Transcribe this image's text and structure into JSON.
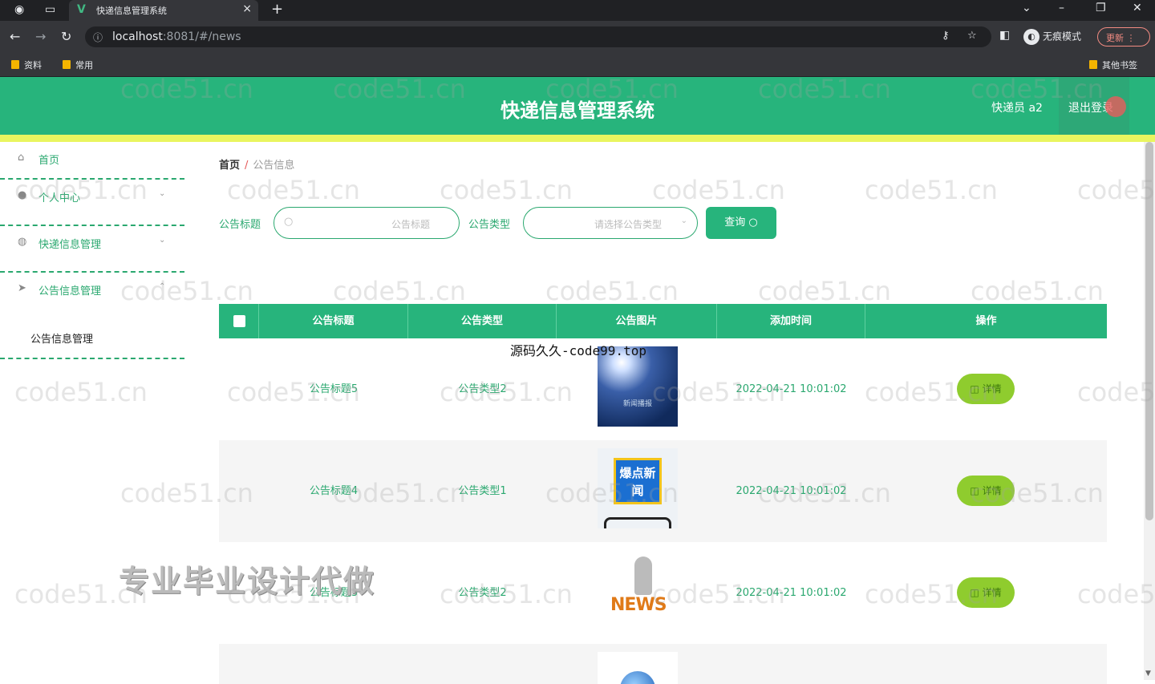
{
  "browser": {
    "tab_title": "快递信息管理系统",
    "url_host": "localhost",
    "url_rest": ":8081/#/news",
    "incognito_label": "无痕模式",
    "update_label": "更新",
    "bookmarks": [
      "资料",
      "常用"
    ],
    "other_bookmarks": "其他书签"
  },
  "header": {
    "title": "快递信息管理系统",
    "user": "快递员 a2",
    "logout": "退出登录"
  },
  "sidebar": {
    "items": [
      {
        "label": "首页",
        "icon": "home-icon"
      },
      {
        "label": "个人中心",
        "icon": "user-icon"
      },
      {
        "label": "快递信息管理",
        "icon": "globe-icon"
      },
      {
        "label": "公告信息管理",
        "icon": "send-icon"
      }
    ],
    "submenu": "公告信息管理"
  },
  "breadcrumb": {
    "home": "首页",
    "sep": "/",
    "current": "公告信息"
  },
  "search": {
    "title_label": "公告标题",
    "title_placeholder": "公告标题",
    "type_label": "公告类型",
    "type_placeholder": "请选择公告类型",
    "query_button": "查询"
  },
  "table": {
    "headers": [
      "公告标题",
      "公告类型",
      "公告图片",
      "添加时间",
      "操作"
    ],
    "rows": [
      {
        "title": "公告标题5",
        "type": "公告类型2",
        "time": "2022-04-21 10:01:02",
        "action": "详情",
        "image_text": "新闻播报"
      },
      {
        "title": "公告标题4",
        "type": "公告类型1",
        "time": "2022-04-21 10:01:02",
        "action": "详情",
        "image_text": "爆点新闻"
      },
      {
        "title": "公告标题3",
        "type": "公告类型2",
        "time": "2022-04-21 10:01:02",
        "action": "详情",
        "image_text": "NEWS"
      }
    ]
  },
  "overlay": {
    "source_text": "源码久久-code99.top",
    "promo_text": "专业毕业设计代做",
    "watermark": "code51.cn"
  }
}
